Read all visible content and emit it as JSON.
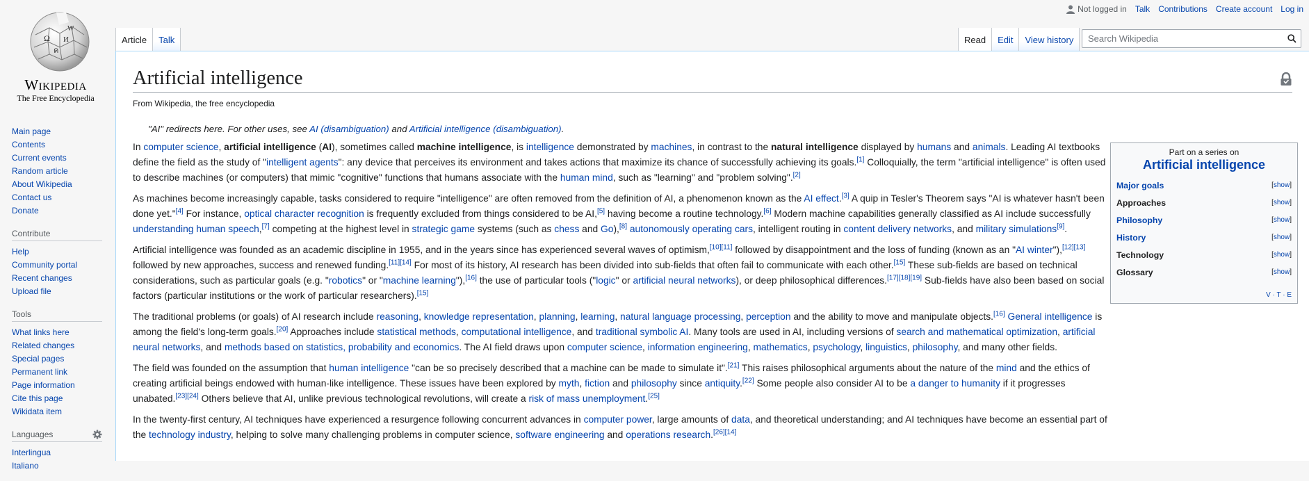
{
  "logo": {
    "wordmark": "Wikipedia",
    "tagline": "The Free Encyclopedia"
  },
  "personal": {
    "not_logged_in": "Not logged in",
    "talk": "Talk",
    "contributions": "Contributions",
    "create_account": "Create account",
    "log_in": "Log in"
  },
  "tabs": {
    "article": "Article",
    "talk": "Talk",
    "read": "Read",
    "edit": "Edit",
    "view_history": "View history"
  },
  "search": {
    "placeholder": "Search Wikipedia"
  },
  "sidebar": {
    "navigation": [
      "Main page",
      "Contents",
      "Current events",
      "Random article",
      "About Wikipedia",
      "Contact us",
      "Donate"
    ],
    "contribute_heading": "Contribute",
    "contribute": [
      "Help",
      "Community portal",
      "Recent changes",
      "Upload file"
    ],
    "tools_heading": "Tools",
    "tools": [
      "What links here",
      "Related changes",
      "Special pages",
      "Permanent link",
      "Page information",
      "Cite this page",
      "Wikidata item"
    ],
    "languages_heading": "Languages",
    "languages": [
      "Interlingua",
      "Italiano"
    ]
  },
  "article": {
    "title": "Artificial intelligence",
    "from": "From Wikipedia, the free encyclopedia",
    "hatnote": {
      "prefix": "\"AI\" redirects here. For other uses, see ",
      "link1": "AI (disambiguation)",
      "mid": " and ",
      "link2": "Artificial intelligence (disambiguation)",
      "suffix": "."
    }
  },
  "sidebox": {
    "pre": "Part on a series on",
    "title": "Artificial intelligence",
    "rows": [
      {
        "label": "Major goals",
        "link": true
      },
      {
        "label": "Approaches",
        "link": false
      },
      {
        "label": "Philosophy",
        "link": true
      },
      {
        "label": "History",
        "link": true
      },
      {
        "label": "Technology",
        "link": false
      },
      {
        "label": "Glossary",
        "link": false
      }
    ],
    "show": "show",
    "vte": "V · T · E"
  },
  "colors": {
    "link": "#0645ad",
    "border": "#a7d7f9",
    "background": "#f6f6f6"
  },
  "paragraphs": [
    [
      [
        "t",
        "In "
      ],
      [
        "a",
        "computer science"
      ],
      [
        "t",
        ", "
      ],
      [
        "b",
        "artificial intelligence"
      ],
      [
        "t",
        " ("
      ],
      [
        "b",
        "AI"
      ],
      [
        "t",
        "), sometimes called "
      ],
      [
        "b",
        "machine intelligence"
      ],
      [
        "t",
        ", is "
      ],
      [
        "a",
        "intelligence"
      ],
      [
        "t",
        " demonstrated by "
      ],
      [
        "a",
        "machines"
      ],
      [
        "t",
        ", in contrast to the "
      ],
      [
        "b",
        "natural intelligence"
      ],
      [
        "t",
        " displayed by "
      ],
      [
        "a",
        "humans"
      ],
      [
        "t",
        " and "
      ],
      [
        "a",
        "animals"
      ],
      [
        "t",
        ". Leading AI textbooks define the field as the study of \""
      ],
      [
        "a",
        "intelligent agents"
      ],
      [
        "t",
        "\": any device that perceives its environment and takes actions that maximize its chance of successfully achieving its goals."
      ],
      [
        "s",
        "[1]"
      ],
      [
        "t",
        " Colloquially, the term \"artificial intelligence\" is often used to describe machines (or computers) that mimic \"cognitive\" functions that humans associate with the "
      ],
      [
        "a",
        "human mind"
      ],
      [
        "t",
        ", such as \"learning\" and \"problem solving\"."
      ],
      [
        "s",
        "[2]"
      ]
    ],
    [
      [
        "t",
        "As machines become increasingly capable, tasks considered to require \"intelligence\" are often removed from the definition of AI, a phenomenon known as the "
      ],
      [
        "a",
        "AI effect"
      ],
      [
        "t",
        "."
      ],
      [
        "s",
        "[3]"
      ],
      [
        "t",
        " A quip in Tesler's Theorem says \"AI is whatever hasn't been done yet.\""
      ],
      [
        "s",
        "[4]"
      ],
      [
        "t",
        " For instance, "
      ],
      [
        "a",
        "optical character recognition"
      ],
      [
        "t",
        " is frequently excluded from things considered to be AI,"
      ],
      [
        "s",
        "[5]"
      ],
      [
        "t",
        " having become a routine technology."
      ],
      [
        "s",
        "[6]"
      ],
      [
        "t",
        " Modern machine capabilities generally classified as AI include successfully "
      ],
      [
        "a",
        "understanding human speech"
      ],
      [
        "t",
        ","
      ],
      [
        "s",
        "[7]"
      ],
      [
        "t",
        " competing at the highest level in "
      ],
      [
        "a",
        "strategic game"
      ],
      [
        "t",
        " systems (such as "
      ],
      [
        "a",
        "chess"
      ],
      [
        "t",
        " and "
      ],
      [
        "a",
        "Go"
      ],
      [
        "t",
        "),"
      ],
      [
        "s",
        "[8]"
      ],
      [
        "t",
        " "
      ],
      [
        "a",
        "autonomously operating cars"
      ],
      [
        "t",
        ", intelligent routing in "
      ],
      [
        "a",
        "content delivery networks"
      ],
      [
        "t",
        ", and "
      ],
      [
        "a",
        "military simulations"
      ],
      [
        "s",
        "[9]"
      ],
      [
        "t",
        "."
      ]
    ],
    [
      [
        "t",
        "Artificial intelligence was founded as an academic discipline in 1955, and in the years since has experienced several waves of optimism,"
      ],
      [
        "s",
        "[10][11]"
      ],
      [
        "t",
        " followed by disappointment and the loss of funding (known as an \""
      ],
      [
        "a",
        "AI winter"
      ],
      [
        "t",
        "\"),"
      ],
      [
        "s",
        "[12][13]"
      ],
      [
        "t",
        " followed by new approaches, success and renewed funding."
      ],
      [
        "s",
        "[11][14]"
      ],
      [
        "t",
        " For most of its history, AI research has been divided into sub-fields that often fail to communicate with each other."
      ],
      [
        "s",
        "[15]"
      ],
      [
        "t",
        " These sub-fields are based on technical considerations, such as particular goals (e.g. \""
      ],
      [
        "a",
        "robotics"
      ],
      [
        "t",
        "\" or \""
      ],
      [
        "a",
        "machine learning"
      ],
      [
        "t",
        "\"),"
      ],
      [
        "s",
        "[16]"
      ],
      [
        "t",
        " the use of particular tools (\""
      ],
      [
        "a",
        "logic"
      ],
      [
        "t",
        "\" or "
      ],
      [
        "a",
        "artificial neural networks"
      ],
      [
        "t",
        "), or deep philosophical differences."
      ],
      [
        "s",
        "[17][18][19]"
      ],
      [
        "t",
        " Sub-fields have also been based on social factors (particular institutions or the work of particular researchers)."
      ],
      [
        "s",
        "[15]"
      ]
    ],
    [
      [
        "t",
        "The traditional problems (or goals) of AI research include "
      ],
      [
        "a",
        "reasoning"
      ],
      [
        "t",
        ", "
      ],
      [
        "a",
        "knowledge representation"
      ],
      [
        "t",
        ", "
      ],
      [
        "a",
        "planning"
      ],
      [
        "t",
        ", "
      ],
      [
        "a",
        "learning"
      ],
      [
        "t",
        ", "
      ],
      [
        "a",
        "natural language processing"
      ],
      [
        "t",
        ", "
      ],
      [
        "a",
        "perception"
      ],
      [
        "t",
        " and the ability to move and manipulate objects."
      ],
      [
        "s",
        "[16]"
      ],
      [
        "t",
        " "
      ],
      [
        "a",
        "General intelligence"
      ],
      [
        "t",
        " is among the field's long-term goals."
      ],
      [
        "s",
        "[20]"
      ],
      [
        "t",
        " Approaches include "
      ],
      [
        "a",
        "statistical methods"
      ],
      [
        "t",
        ", "
      ],
      [
        "a",
        "computational intelligence"
      ],
      [
        "t",
        ", and "
      ],
      [
        "a",
        "traditional symbolic AI"
      ],
      [
        "t",
        ". Many tools are used in AI, including versions of "
      ],
      [
        "a",
        "search and mathematical optimization"
      ],
      [
        "t",
        ", "
      ],
      [
        "a",
        "artificial neural networks"
      ],
      [
        "t",
        ", and "
      ],
      [
        "a",
        "methods based on statistics, probability and economics"
      ],
      [
        "t",
        ". The AI field draws upon "
      ],
      [
        "a",
        "computer science"
      ],
      [
        "t",
        ", "
      ],
      [
        "a",
        "information engineering"
      ],
      [
        "t",
        ", "
      ],
      [
        "a",
        "mathematics"
      ],
      [
        "t",
        ", "
      ],
      [
        "a",
        "psychology"
      ],
      [
        "t",
        ", "
      ],
      [
        "a",
        "linguistics"
      ],
      [
        "t",
        ", "
      ],
      [
        "a",
        "philosophy"
      ],
      [
        "t",
        ", and many other fields."
      ]
    ],
    [
      [
        "t",
        "The field was founded on the assumption that "
      ],
      [
        "a",
        "human intelligence"
      ],
      [
        "t",
        " \"can be so precisely described that a machine can be made to simulate it\"."
      ],
      [
        "s",
        "[21]"
      ],
      [
        "t",
        " This raises philosophical arguments about the nature of the "
      ],
      [
        "a",
        "mind"
      ],
      [
        "t",
        " and the ethics of creating artificial beings endowed with human-like intelligence. These issues have been explored by "
      ],
      [
        "a",
        "myth"
      ],
      [
        "t",
        ", "
      ],
      [
        "a",
        "fiction"
      ],
      [
        "t",
        " and "
      ],
      [
        "a",
        "philosophy"
      ],
      [
        "t",
        " since "
      ],
      [
        "a",
        "antiquity"
      ],
      [
        "t",
        "."
      ],
      [
        "s",
        "[22]"
      ],
      [
        "t",
        " Some people also consider AI to be "
      ],
      [
        "a",
        "a danger to humanity"
      ],
      [
        "t",
        " if it progresses unabated."
      ],
      [
        "s",
        "[23][24]"
      ],
      [
        "t",
        " Others believe that AI, unlike previous technological revolutions, will create a "
      ],
      [
        "a",
        "risk of mass unemployment"
      ],
      [
        "t",
        "."
      ],
      [
        "s",
        "[25]"
      ]
    ],
    [
      [
        "t",
        "In the twenty-first century, AI techniques have experienced a resurgence following concurrent advances in "
      ],
      [
        "a",
        "computer power"
      ],
      [
        "t",
        ", large amounts of "
      ],
      [
        "a",
        "data"
      ],
      [
        "t",
        ", and theoretical understanding; and AI techniques have become an essential part of the "
      ],
      [
        "a",
        "technology industry"
      ],
      [
        "t",
        ", helping to solve many challenging problems in computer science, "
      ],
      [
        "a",
        "software engineering"
      ],
      [
        "t",
        " and "
      ],
      [
        "a",
        "operations research"
      ],
      [
        "t",
        "."
      ],
      [
        "s",
        "[26][14]"
      ]
    ]
  ]
}
